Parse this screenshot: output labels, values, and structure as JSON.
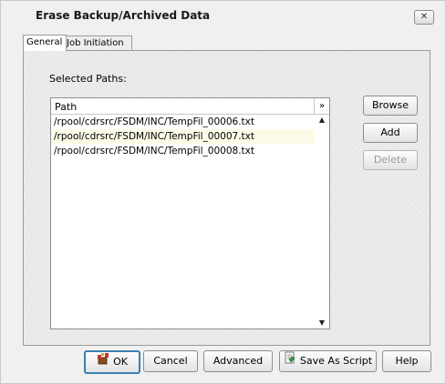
{
  "window": {
    "title": "Erase Backup/Archived Data",
    "close_icon": "close-icon"
  },
  "tabs": [
    {
      "label": "General"
    },
    {
      "label": "Job Initiation"
    }
  ],
  "general": {
    "selected_paths_label": "Selected Paths:",
    "list": {
      "column_header": "Path",
      "rows": [
        "/rpool/cdrsrc/FSDM/INC/TempFil_00006.txt",
        "/rpool/cdrsrc/FSDM/INC/TempFil_00007.txt",
        "/rpool/cdrsrc/FSDM/INC/TempFil_00008.txt"
      ]
    },
    "buttons": {
      "browse": "Browse",
      "add": "Add",
      "delete": "Delete"
    }
  },
  "footer": {
    "ok": "OK",
    "cancel": "Cancel",
    "advanced": "Advanced",
    "save_as_script": "Save As Script",
    "help": "Help"
  },
  "colors": {
    "ok_border": "#3c7fb1",
    "highlight_row": "#fbfbe8"
  }
}
